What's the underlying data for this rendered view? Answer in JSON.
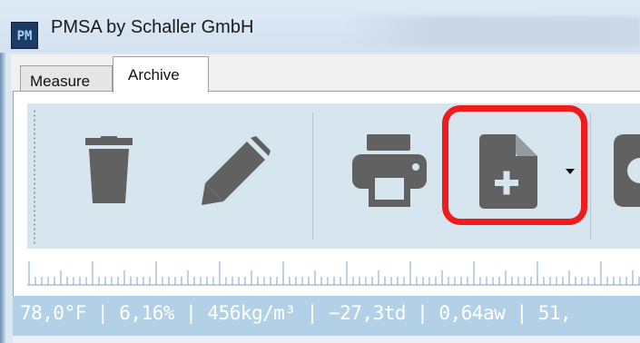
{
  "window": {
    "title": "PMSA by Schaller GmbH",
    "icon_text": "PM"
  },
  "tabs": [
    {
      "label": "Measure",
      "selected": false
    },
    {
      "label": "Archive",
      "selected": true
    }
  ],
  "toolbar": {
    "tools": [
      {
        "name": "delete",
        "icon": "trash-icon"
      },
      {
        "name": "edit",
        "icon": "pencil-icon"
      },
      {
        "name": "print",
        "icon": "printer-icon"
      },
      {
        "name": "new-document",
        "icon": "add-document-icon",
        "has_dropdown": true,
        "highlighted": true
      },
      {
        "name": "more",
        "icon": "partial-tool-icon"
      }
    ]
  },
  "status": {
    "text": "78,0°F | 6,16% | 456kg/m³ | −27,3td | 0,64aw | 51,"
  },
  "colors": {
    "icon_gray": "#616161",
    "toolbar_bg": "#d6e5ee",
    "highlight_red": "#ee1c1c",
    "status_bg": "#b3d1e6"
  }
}
